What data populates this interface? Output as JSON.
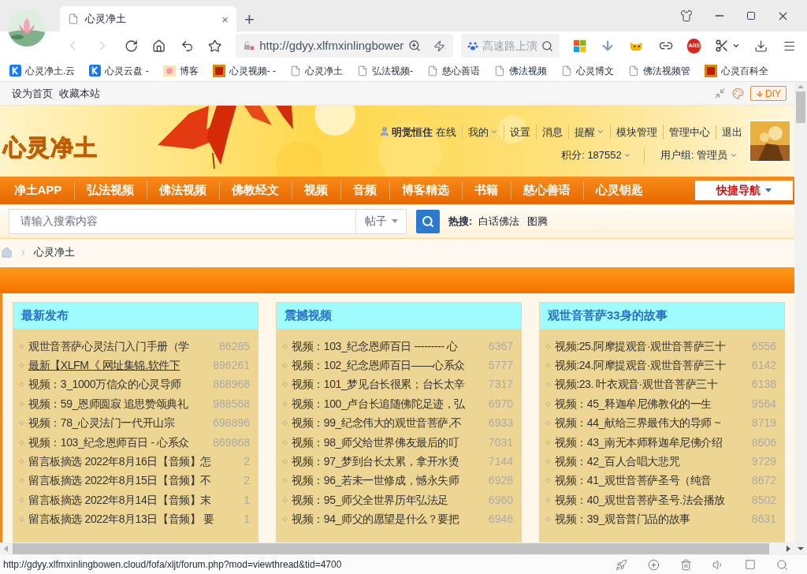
{
  "browser": {
    "tab": {
      "title": "心灵净土",
      "close": "×"
    },
    "new_tab": "+",
    "url": "http://gdyy.xlfmxinlingbower",
    "search_placeholder": "高速路上演",
    "adblock_label": "ABS",
    "bookmarks": [
      {
        "label": "心灵净土.云",
        "kind": "k"
      },
      {
        "label": "心灵云盘 -",
        "kind": "k"
      },
      {
        "label": "博客"
      },
      {
        "label": "心灵视频- -",
        "kind": "seal"
      },
      {
        "label": "心灵净土",
        "kind": "page"
      },
      {
        "label": "弘法视频-",
        "kind": "page"
      },
      {
        "label": "慈心善语",
        "kind": "page"
      },
      {
        "label": "佛法视频",
        "kind": "page"
      },
      {
        "label": "心灵博文",
        "kind": "page"
      },
      {
        "label": "佛法视频管",
        "kind": "page"
      },
      {
        "label": "心灵百科全",
        "kind": "seal"
      }
    ],
    "diy_label": "DIY"
  },
  "topbar": {
    "links": [
      "设为首页",
      "收藏本站"
    ]
  },
  "header": {
    "logo": "心灵净土",
    "user": {
      "name": "明觉恒住",
      "status": "在线",
      "links": [
        {
          "label": "我的",
          "dropdown": true
        },
        {
          "label": "设置",
          "dropdown": false
        },
        {
          "label": "消息",
          "dropdown": false
        },
        {
          "label": "提醒",
          "dropdown": true
        },
        {
          "label": "模块管理",
          "dropdown": false
        },
        {
          "label": "管理中心",
          "dropdown": false
        },
        {
          "label": "退出",
          "dropdown": false
        }
      ],
      "points": "积分: 187552",
      "group": "用户组: 管理员"
    }
  },
  "nav": {
    "items": [
      "净土APP",
      "弘法视频",
      "佛法视频",
      "佛教经文",
      "视频",
      "音频",
      "博客精选",
      "书籍",
      "慈心善语",
      "心灵钥匙"
    ],
    "quick_nav": "快捷导航"
  },
  "search": {
    "placeholder": "请输入搜索内容",
    "type": "帖子",
    "hot_label": "热搜:",
    "hot_terms": [
      "白话佛法",
      "图腾"
    ]
  },
  "breadcrumb": {
    "current": "心灵净土"
  },
  "columns": [
    {
      "title": "最新发布",
      "items": [
        {
          "title": "观世音菩萨心灵法门入门手册（学",
          "count": "86285",
          "hovered": false
        },
        {
          "title": "最新【XLFM《 网址集锦.软件下",
          "count": "896261",
          "hovered": true
        },
        {
          "title": "视频：3_1000万信众的心灵导师",
          "count": "868968",
          "hovered": false
        },
        {
          "title": "视频：59_恩师圆寂 追思赞颂典礼",
          "count": "988568",
          "hovered": false
        },
        {
          "title": "视频：78_心灵法门一代开山宗",
          "count": "698896",
          "hovered": false
        },
        {
          "title": "视频：103_纪念恩师百日 - 心系众",
          "count": "869868",
          "hovered": false
        },
        {
          "title": "留言板摘选 2022年8月16日【音频】怎",
          "count": "2",
          "hovered": false
        },
        {
          "title": "留言板摘选 2022年8月15日【音频】不",
          "count": "2",
          "hovered": false
        },
        {
          "title": "留言板摘选 2022年8月14日【音频】末",
          "count": "1",
          "hovered": false
        },
        {
          "title": "留言板摘选 2022年8月13日【音频】 要",
          "count": "1",
          "hovered": false
        }
      ]
    },
    {
      "title": "震撼视频",
      "items": [
        {
          "title": "视频：103_纪念恩师百日 --------- 心",
          "count": "6367",
          "hovered": false
        },
        {
          "title": "视频：102_纪念恩师百日——心系众",
          "count": "5777",
          "hovered": false
        },
        {
          "title": "视频：101_梦见台长很累；台长太辛",
          "count": "7317",
          "hovered": false
        },
        {
          "title": "视频：100_卢台长追随佛陀足迹，弘",
          "count": "6970",
          "hovered": false
        },
        {
          "title": "视频：99_纪念伟大的观世音菩萨,不",
          "count": "6933",
          "hovered": false
        },
        {
          "title": "视频：98_师父给世界佛友最后的叮",
          "count": "7031",
          "hovered": false
        },
        {
          "title": "视频：97_梦到台长太累，拿开水烫",
          "count": "7144",
          "hovered": false
        },
        {
          "title": "视频：96_若未一世修成，憾永失师",
          "count": "6928",
          "hovered": false
        },
        {
          "title": "视频：95_师父全世界历年弘法足",
          "count": "6960",
          "hovered": false
        },
        {
          "title": "视频：94_师父的愿望是什么？要把",
          "count": "6946",
          "hovered": false
        }
      ]
    },
    {
      "title": "观世音菩萨33身的故事",
      "items": [
        {
          "title": "视频:25.阿摩提观音·观世音菩萨三十",
          "count": "6556",
          "hovered": false
        },
        {
          "title": "视频:24.阿摩提观音·观世音菩萨三十",
          "count": "6142",
          "hovered": false
        },
        {
          "title": "视频:23. 叶衣观音·观世音菩萨三十",
          "count": "6138",
          "hovered": false
        },
        {
          "title": "视频：45_释迦牟尼佛教化的一生",
          "count": "9564",
          "hovered": false
        },
        {
          "title": "视频：44_献给三界最伟大的导师 ~",
          "count": "8719",
          "hovered": false
        },
        {
          "title": "视频：43_南无本师释迦牟尼佛介绍",
          "count": "8606",
          "hovered": false
        },
        {
          "title": "视频：42_百人合唱大悲咒",
          "count": "9729",
          "hovered": false
        },
        {
          "title": "视频：41_观世音菩萨圣号（纯音",
          "count": "8672",
          "hovered": false
        },
        {
          "title": "视频：40_观世音菩萨圣号.法会播放",
          "count": "8502",
          "hovered": false
        },
        {
          "title": "视频：39_观音普门品的故事",
          "count": "8631",
          "hovered": false
        }
      ]
    }
  ],
  "status_bar": {
    "url": "http://gdyy.xlfmxinlingbowen.cloud/fofa/xljt/forum.php?mod=viewthread&tid=4700"
  }
}
